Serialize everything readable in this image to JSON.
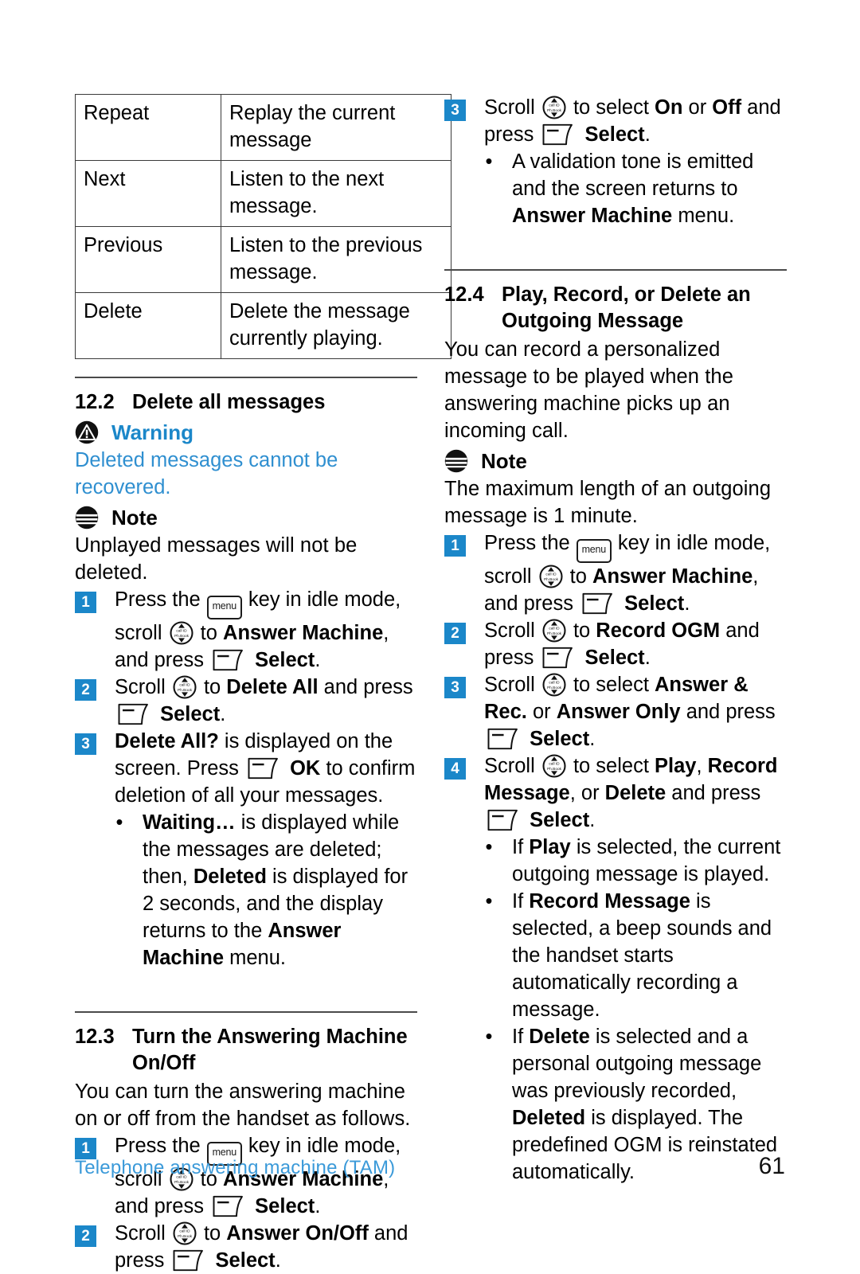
{
  "page": {
    "number": "61",
    "footer_section": "Telephone answering machine (TAM)",
    "accent_blue": "#1b87c9",
    "link_blue": "#3b9ad9"
  },
  "icons": {
    "menu_key_label": "menu",
    "scroll_key_top_label": "call ID",
    "scroll_key_bottom_label": "Ph.Book",
    "warning_icon": "warning-triangle-in-circle-icon",
    "note_icon": "note-lines-in-circle-icon",
    "softkey_icon": "left-softkey-icon",
    "scroll_icon": "up-down-scroll-key-icon",
    "menu_icon": "menu-key-icon"
  },
  "key_table": {
    "rows": [
      {
        "key": "Repeat",
        "desc": "Replay the current message"
      },
      {
        "key": "Next",
        "desc": "Listen to the next message."
      },
      {
        "key": "Previous",
        "desc": "Listen to the previous message."
      },
      {
        "key": "Delete",
        "desc": "Delete the message currently playing."
      }
    ]
  },
  "section_12_2": {
    "number": "12.2",
    "title": "Delete all messages",
    "warning_label": "Warning",
    "warning_body": "Deleted messages cannot be recovered.",
    "note_label": "Note",
    "note_body": "Unplayed messages will not be deleted.",
    "steps": [
      {
        "n": "1",
        "parts": [
          "Press the ",
          "[menu]",
          " key in idle mode, scroll ",
          "[scroll]",
          " to ",
          "**Answer Machine**",
          ", and press ",
          "[soft]",
          " ",
          "**Select**",
          "."
        ]
      },
      {
        "n": "2",
        "parts": [
          "Scroll ",
          "[scroll]",
          " to ",
          "**Delete All**",
          " and press ",
          "[soft]",
          " ",
          "**Select**",
          "."
        ]
      },
      {
        "n": "3",
        "parts": [
          "**Delete All?**",
          " is displayed on the screen. Press ",
          "[soft]",
          " ",
          "**OK**",
          " to confirm deletion of all your messages."
        ]
      }
    ],
    "step3_bullet": "Waiting... is displayed while the messages are deleted; then, Deleted is displayed for 2 seconds, and the display returns to the Answer Machine menu.",
    "step3_bullet_bold": [
      "Waiting…",
      "Deleted",
      "Answer Machine"
    ]
  },
  "section_12_3": {
    "number": "12.3",
    "title_line1": "Turn the Answering Machine",
    "title_line2": "On/Off",
    "intro": "You can turn the answering machine on or off from the handset as follows.",
    "steps": [
      {
        "n": "1"
      },
      {
        "n": "2"
      }
    ]
  },
  "section_12_4": {
    "number": "12.4",
    "title_line1": "Play, Record, or Delete an",
    "title_line2": "Outgoing Message",
    "intro": "You can record a personalized message to be played when the answering machine picks up an incoming call.",
    "note_label": "Note",
    "note_body": "The maximum length of an outgoing message is 1 minute.",
    "bullets": [
      "If Play is selected, the current outgoing message is played.",
      "If Record Message is selected, a beep sounds and the handset starts automatically recording a message.",
      "If Delete is selected and a personal outgoing message was previously recorded, Deleted is displayed. The predefined OGM is reinstated automatically."
    ]
  },
  "right_top_step": {
    "n": "3",
    "bullet": "A validation tone is emitted and the screen returns to Answer Machine menu."
  },
  "text": {
    "press_the": "Press the ",
    "key_in_idle": " key in idle mode, scroll ",
    "to": " to ",
    "and_press": ", and press ",
    "select": "Select",
    "ok": "OK",
    "answer_machine": "Answer Machine",
    "delete_all": "Delete All",
    "delete_all_q": "Delete All?",
    "answer_on_off": "Answer On/Off",
    "record_ogm": "Record OGM",
    "answer_rec": "Answer & Rec.",
    "answer_only": "Answer Only",
    "play": "Play",
    "record_message": "Record Message",
    "delete": "Delete",
    "on": "On",
    "off": "Off",
    "scroll": "Scroll ",
    "press": "press ",
    "and": " and ",
    "or": " or ",
    "period": ".",
    "comma": ", "
  }
}
